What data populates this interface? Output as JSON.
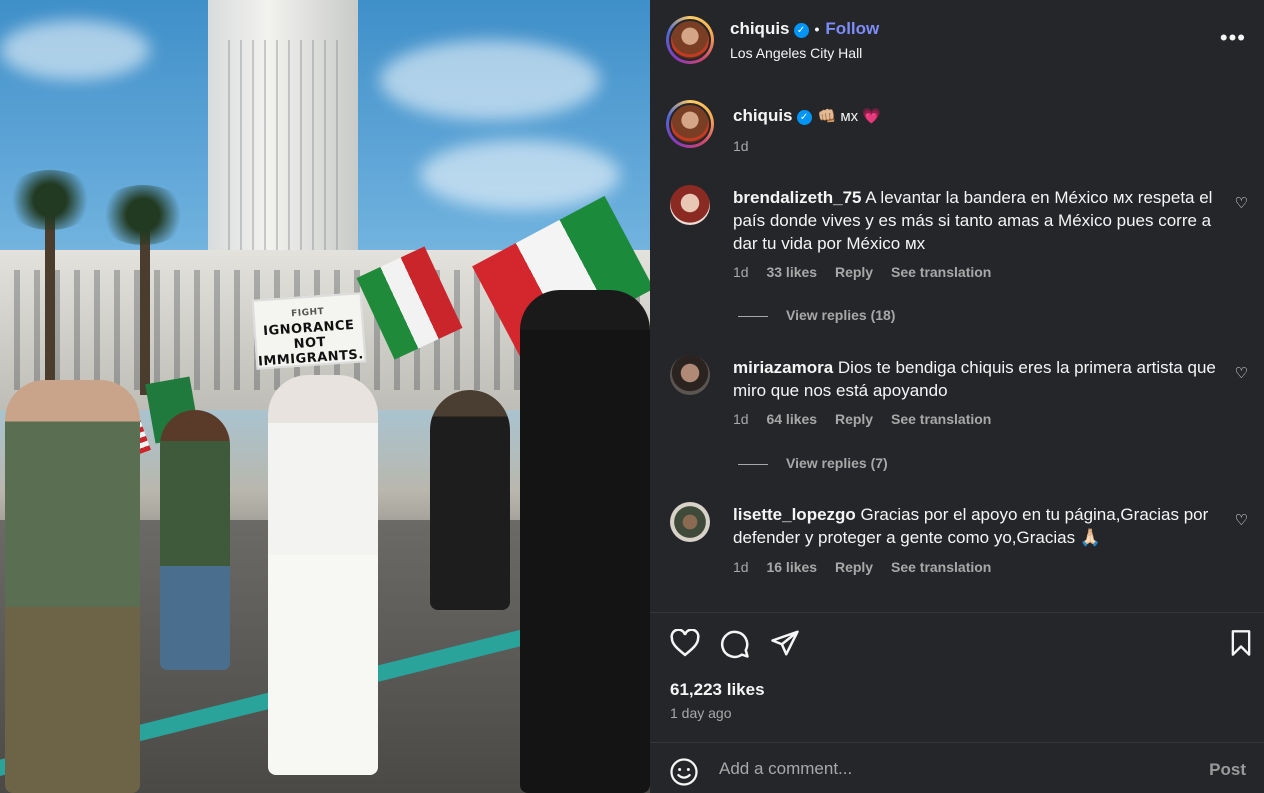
{
  "photo": {
    "sign_line1": "FIGHT",
    "sign_line2": "IGNORANCE",
    "sign_line3": "NOT",
    "sign_line4": "IMMIGRANTS."
  },
  "header": {
    "username": "chiquis",
    "follow_label": "Follow",
    "location": "Los Angeles City Hall",
    "more_label": "•••"
  },
  "caption": {
    "username": "chiquis",
    "text": "👊🏼 ᴍx 💗",
    "time": "1d"
  },
  "comments": [
    {
      "username": "brendalizeth_75",
      "text": "A levantar la bandera en México ᴍx respeta el país donde vives y es más si tanto amas a México pues corre a dar tu vida por México ᴍx",
      "time": "1d",
      "likes": "33 likes",
      "reply": "Reply",
      "translate": "See translation",
      "view_replies": "View replies (18)"
    },
    {
      "username": "miriazamora",
      "text": "Dios te bendiga chiquis eres la primera artista que miro que nos está apoyando",
      "time": "1d",
      "likes": "64 likes",
      "reply": "Reply",
      "translate": "See translation",
      "view_replies": "View replies (7)"
    },
    {
      "username": "lisette_lopezgo",
      "text": "Gracias por el apoyo en tu página,Gracias por defender y proteger a gente como yo,Gracias 🙏🏻",
      "time": "1d",
      "likes": "16 likes",
      "reply": "Reply",
      "translate": "See translation"
    }
  ],
  "stats": {
    "likes": "61,223 likes",
    "ago": "1 day ago"
  },
  "add_comment": {
    "placeholder": "Add a comment...",
    "post_label": "Post"
  },
  "icons": {
    "like": "heart-icon",
    "comment": "comment-icon",
    "share": "share-icon",
    "save": "bookmark-icon",
    "emoji": "emoji-icon",
    "verified": "verified-badge-icon",
    "more": "more-options-icon"
  },
  "colors": {
    "panel_bg": "#25262a",
    "follow": "#7c8cf8",
    "verified": "#0095f6",
    "secondary_text": "#a8a8a8"
  }
}
